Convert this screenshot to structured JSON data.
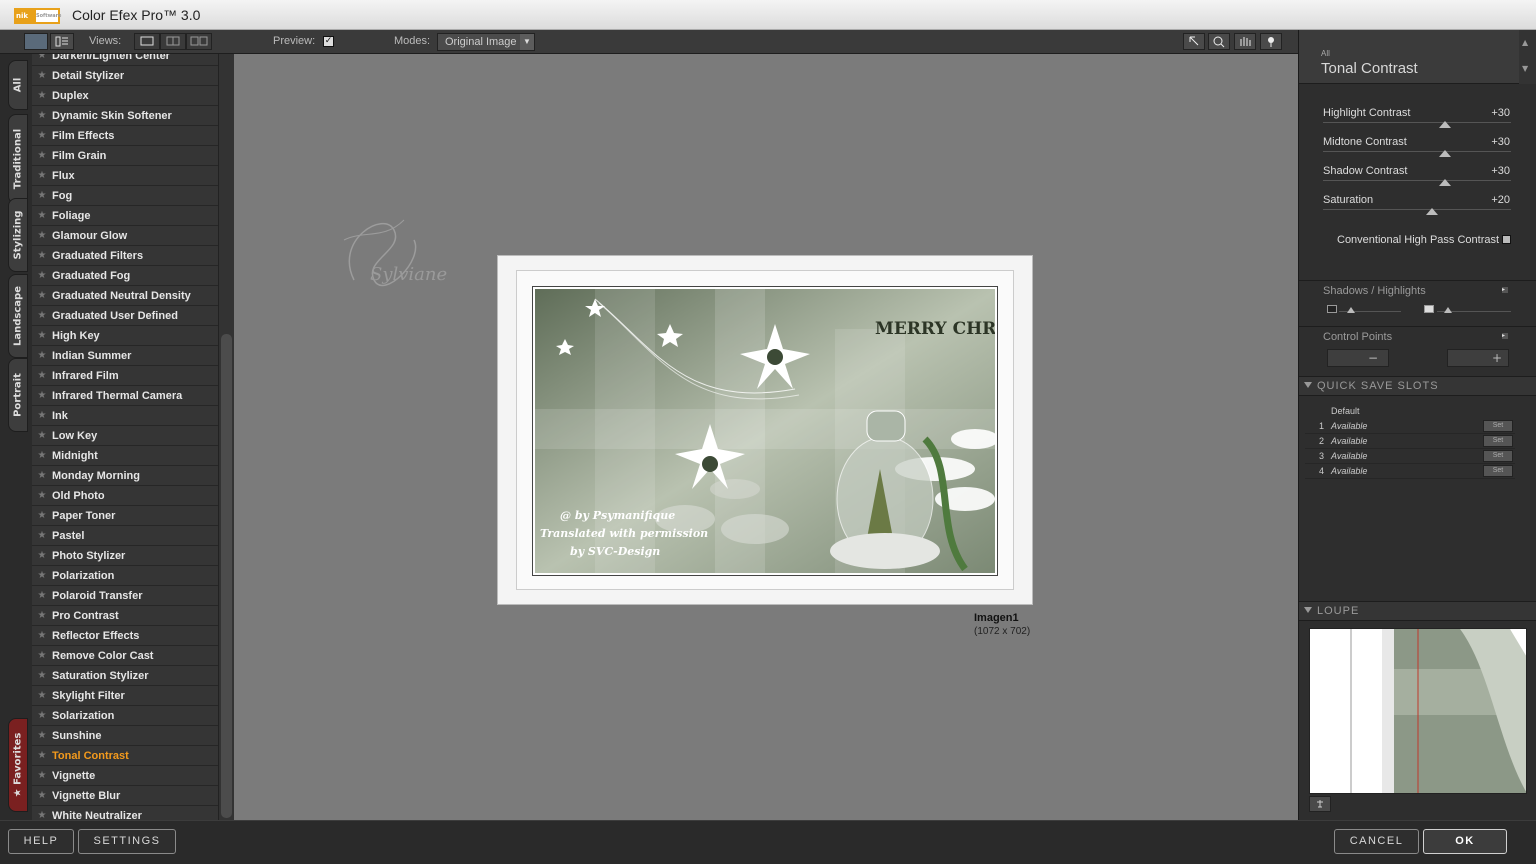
{
  "app": {
    "logo_text": "nik",
    "logo_sub": "Software",
    "title": "Color Efex Pro™ 3.0"
  },
  "toolbar": {
    "views_label": "Views:",
    "preview_label": "Preview:",
    "preview_checked": true,
    "modes_label": "Modes:",
    "mode_value": "Original Image",
    "tools": [
      "pointer-icon",
      "zoom-icon",
      "hand-icon",
      "control-point-icon"
    ]
  },
  "sidetabs": [
    "All",
    "Traditional",
    "Stylizing",
    "Landscape",
    "Portrait",
    "Favorites"
  ],
  "filters": [
    "Darken/Lighten Center",
    "Detail Stylizer",
    "Duplex",
    "Dynamic Skin Softener",
    "Film Effects",
    "Film Grain",
    "Flux",
    "Fog",
    "Foliage",
    "Glamour Glow",
    "Graduated Filters",
    "Graduated Fog",
    "Graduated Neutral Density",
    "Graduated User Defined",
    "High Key",
    "Indian Summer",
    "Infrared Film",
    "Infrared Thermal Camera",
    "Ink",
    "Low Key",
    "Midnight",
    "Monday Morning",
    "Old Photo",
    "Paper Toner",
    "Pastel",
    "Photo Stylizer",
    "Polarization",
    "Polaroid Transfer",
    "Pro Contrast",
    "Reflector Effects",
    "Remove Color Cast",
    "Saturation Stylizer",
    "Skylight Filter",
    "Solarization",
    "Sunshine",
    "Tonal Contrast",
    "Vignette",
    "Vignette Blur",
    "White Neutralizer"
  ],
  "active_filter": "Tonal Contrast",
  "canvas": {
    "watermark": "Sylviane",
    "image_name": "Imagen1",
    "image_size": "(1072 x 702)",
    "photo_title": "MERRY CHRISTMAS",
    "photo_credit_1": "@ by Psymanifique",
    "photo_credit_2": "Translated with permission",
    "photo_credit_3": "by SVC-Design"
  },
  "panel": {
    "category": "All",
    "filter_name": "Tonal Contrast",
    "sliders": [
      {
        "label": "Highlight Contrast",
        "value": "+30",
        "level": 0.65
      },
      {
        "label": "Midtone Contrast",
        "value": "+30",
        "level": 0.65
      },
      {
        "label": "Shadow Contrast",
        "value": "+30",
        "level": 0.65
      },
      {
        "label": "Saturation",
        "value": "+20",
        "level": 0.58
      }
    ],
    "checkbox_label": "Conventional High Pass Contrast",
    "shadows_highlights": "Shadows / Highlights",
    "control_points": "Control Points",
    "quick_save_title": "QUICK SAVE SLOTS",
    "default_label": "Default",
    "slots": [
      {
        "n": "1",
        "status": "Available",
        "set": "Set"
      },
      {
        "n": "2",
        "status": "Available",
        "set": "Set"
      },
      {
        "n": "3",
        "status": "Available",
        "set": "Set"
      },
      {
        "n": "4",
        "status": "Available",
        "set": "Set"
      }
    ],
    "loupe_title": "LOUPE"
  },
  "bottom": {
    "help": "HELP",
    "settings": "SETTINGS",
    "cancel": "CANCEL",
    "ok": "OK"
  },
  "colors": {
    "active": "#f39a1d",
    "canvas": "#7b7b7b",
    "panel": "#2e2e2e"
  }
}
